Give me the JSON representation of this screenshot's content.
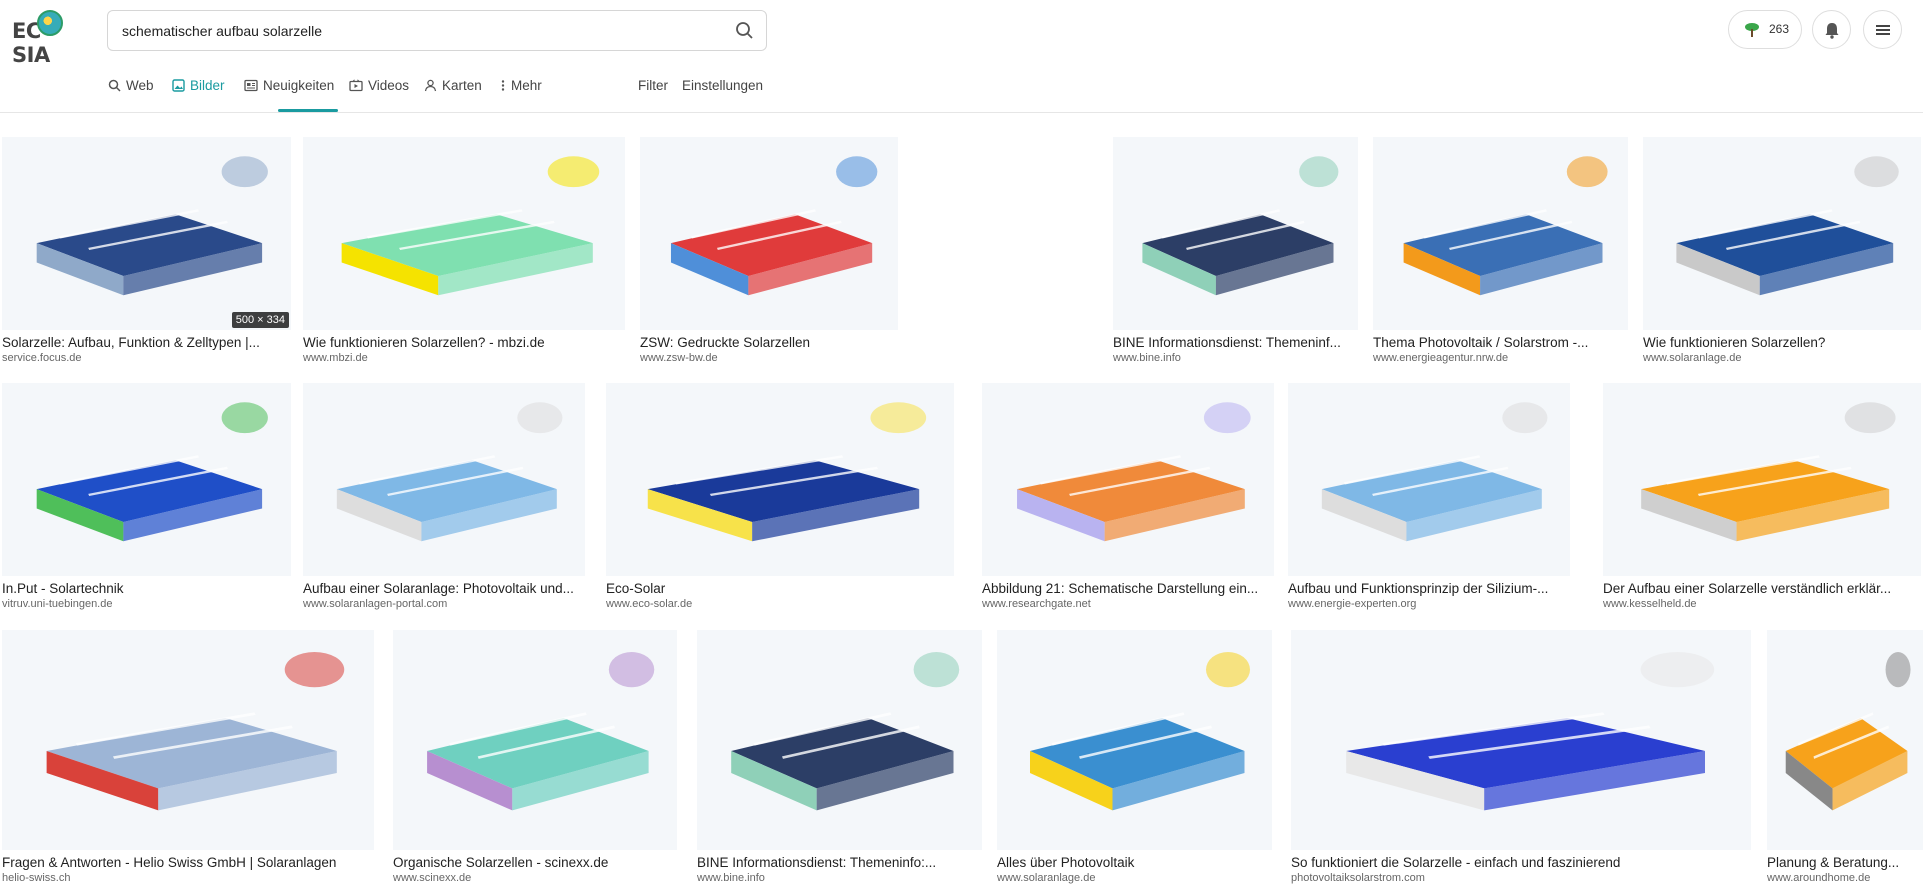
{
  "logo": {
    "text": "EC   SIA"
  },
  "search": {
    "query": "schematischer aufbau solarzelle"
  },
  "header": {
    "tree_count": "263"
  },
  "nav": {
    "web": "Web",
    "images": "Bilder",
    "news": "Neuigkeiten",
    "videos": "Videos",
    "maps": "Karten",
    "more": "Mehr",
    "filter": "Filter",
    "settings": "Einstellungen"
  },
  "results": [
    {
      "title": "Solarzelle: Aufbau, Funktion & Zelltypen |...",
      "source": "service.focus.de",
      "size": "500 × 334",
      "colors": [
        "#2a4a8a",
        "#8fa9c9"
      ]
    },
    {
      "title": "Wie funktionieren Solarzellen? - mbzi.de",
      "source": "www.mbzi.de",
      "colors": [
        "#7fe0b0",
        "#f5e300"
      ]
    },
    {
      "title": "ZSW: Gedruckte Solarzellen",
      "source": "www.zsw-bw.de",
      "colors": [
        "#e03b3b",
        "#4f8fd9"
      ]
    },
    {
      "title": "BINE Informationsdienst: Themeninf...",
      "source": "www.bine.info",
      "colors": [
        "#2c3e66",
        "#8fd0b8"
      ]
    },
    {
      "title": "Thema Photovoltaik / Solarstrom -...",
      "source": "www.energieagentur.nrw.de",
      "colors": [
        "#3a6fb5",
        "#f39a1b"
      ]
    },
    {
      "title": "Wie funktionieren Solarzellen?",
      "source": "www.solaranlage.de",
      "colors": [
        "#1f4f9a",
        "#c9c9c9"
      ]
    },
    {
      "title": "In.Put - Solartechnik",
      "source": "vitruv.uni-tuebingen.de",
      "colors": [
        "#1f4fc8",
        "#4fbf5a"
      ]
    },
    {
      "title": "Aufbau einer Solaranlage: Photovoltaik und...",
      "source": "www.solaranlagen-portal.com",
      "colors": [
        "#7fb8e6",
        "#dddddd"
      ]
    },
    {
      "title": "Eco-Solar",
      "source": "www.eco-solar.de",
      "colors": [
        "#1a3a9a",
        "#f7e24a"
      ]
    },
    {
      "title": "Abbildung 21: Schematische Darstellung ein...",
      "source": "www.researchgate.net",
      "colors": [
        "#f08a3a",
        "#b9b3f0"
      ]
    },
    {
      "title": "Aufbau und Funktionsprinzip der Silizium-...",
      "source": "www.energie-experten.org",
      "colors": [
        "#7fb8e6",
        "#dddddd"
      ]
    },
    {
      "title": "Der Aufbau einer Solarzelle verständlich erklär...",
      "source": "www.kesselheld.de",
      "colors": [
        "#f7a21b",
        "#cfcfcf"
      ]
    },
    {
      "title": "Fragen & Antworten - Helio Swiss GmbH | Solaranlagen",
      "source": "helio-swiss.ch",
      "colors": [
        "#9db5d6",
        "#d9423a"
      ]
    },
    {
      "title": "Organische Solarzellen - scinexx.de",
      "source": "www.scinexx.de",
      "colors": [
        "#6fd0c0",
        "#b78fd0"
      ]
    },
    {
      "title": "BINE Informationsdienst: Themeninfo:...",
      "source": "www.bine.info",
      "colors": [
        "#2c3e66",
        "#8fd0b8"
      ]
    },
    {
      "title": "Alles über Photovoltaik",
      "source": "www.solaranlage.de",
      "colors": [
        "#3a8fd0",
        "#f7d21b"
      ]
    },
    {
      "title": "So funktioniert die Solarzelle - einfach und faszinierend",
      "source": "photovoltaiksolarstrom.com",
      "colors": [
        "#2a3fd0",
        "#e8e8e8"
      ]
    },
    {
      "title": "Planung & Beratung...",
      "source": "www.aroundhome.de",
      "colors": [
        "#f7a21b",
        "#888888"
      ]
    }
  ]
}
